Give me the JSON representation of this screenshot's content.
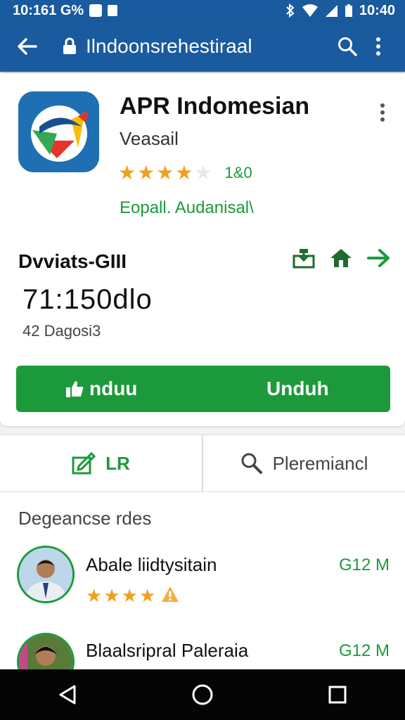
{
  "status_bar": {
    "time_left": "10:161 G%",
    "time_right": "10:40",
    "icons": [
      "square-icon",
      "small-square-icon",
      "bluetooth-icon",
      "wifi-icon",
      "signal-icon",
      "battery-icon"
    ]
  },
  "app_bar": {
    "title": "Ilndoonsrehestiraal",
    "icons": [
      "back-arrow-icon",
      "lock-icon",
      "search-icon",
      "more-vert-icon"
    ]
  },
  "app": {
    "name": "APR Indomesian",
    "developer": "Veasail",
    "rating": 4,
    "rating_count": "1&0",
    "category": "Eopall. Audanisal\\"
  },
  "details": {
    "section_title": "Dvviats-GIII",
    "size_value": "71:150dlo",
    "date": "42 Dagosi3",
    "action_icons": [
      "download-box-icon",
      "home-icon",
      "arrow-right-icon"
    ]
  },
  "install_button": {
    "left_label": "nduu",
    "right_label": "Unduh"
  },
  "tabs": [
    {
      "label": "LR",
      "icon": "edit-box-icon"
    },
    {
      "label": "Pleremiancl",
      "icon": "search-icon"
    }
  ],
  "list": {
    "header": "Degeancse rdes",
    "items": [
      {
        "name": "Abale liidtysitain",
        "size": "G12 M",
        "rating": 4
      },
      {
        "name": "Blaalsripral Paleraia",
        "size": "G12 M"
      }
    ]
  },
  "colors": {
    "primary_blue": "#1a5a9e",
    "accent_green": "#1c9a3b",
    "star": "#f0a020"
  }
}
